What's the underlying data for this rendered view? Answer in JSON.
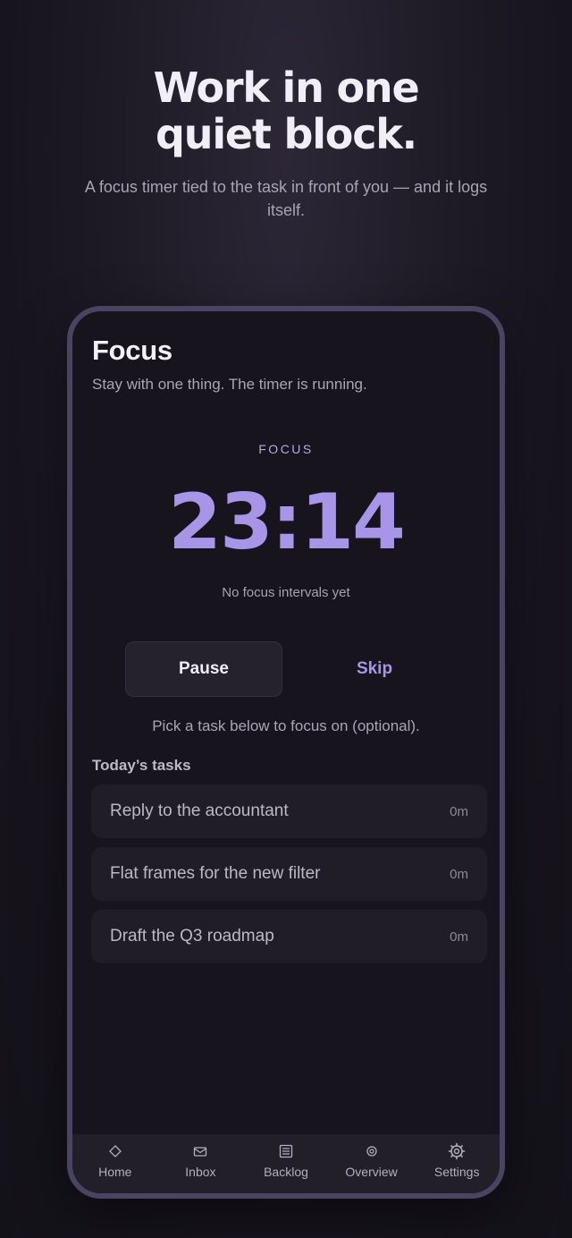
{
  "hero": {
    "headline_line1": "Work in one",
    "headline_line2": "quiet block.",
    "subhead": "A focus timer tied to the task in front of you — and it logs itself."
  },
  "screen": {
    "title": "Focus",
    "subtitle": "Stay with one thing. The timer is running.",
    "mode_label": "FOCUS",
    "timer": "23:14",
    "intervals_text": "No focus intervals yet",
    "pause_label": "Pause",
    "skip_label": "Skip",
    "hint": "Pick a task below to focus on (optional).",
    "tasks_heading": "Today’s tasks",
    "tasks": [
      {
        "name": "Reply to the accountant",
        "time": "0m"
      },
      {
        "name": "Flat frames for the new filter",
        "time": "0m"
      },
      {
        "name": "Draft the Q3 roadmap",
        "time": "0m"
      }
    ]
  },
  "tabbar": {
    "items": [
      {
        "label": "Home",
        "icon": "diamond-icon"
      },
      {
        "label": "Inbox",
        "icon": "inbox-icon"
      },
      {
        "label": "Backlog",
        "icon": "list-icon"
      },
      {
        "label": "Overview",
        "icon": "target-icon"
      },
      {
        "label": "Settings",
        "icon": "gear-icon"
      }
    ]
  },
  "colors": {
    "accent": "#a995e8",
    "background": "#17141d",
    "frame": "#4a4462"
  }
}
